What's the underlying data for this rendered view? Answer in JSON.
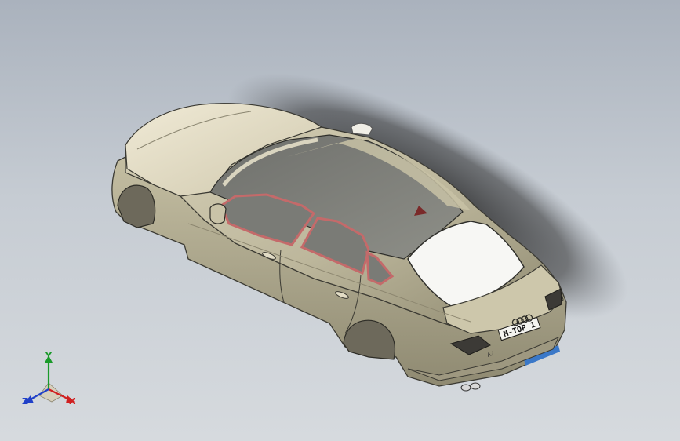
{
  "viewport": {
    "model": "car-body",
    "license_plate": "M-TOP 1",
    "trunk_badge": "A7",
    "colors": {
      "background_top": "#aab2bd",
      "background_bottom": "#d6dade",
      "body": "#c9c4a8",
      "body_light": "#e8e2cc",
      "glass": "#7e7f7a",
      "window_frame": "#c46a6a",
      "rear_window": "#f6f6f3",
      "plate_strip": "#3a78c8"
    }
  },
  "triad": {
    "y_label": "Y",
    "x_label": "X",
    "z_label": "Z",
    "colors": {
      "x": "#d02020",
      "y": "#1a9a2a",
      "z": "#2040c8"
    }
  }
}
